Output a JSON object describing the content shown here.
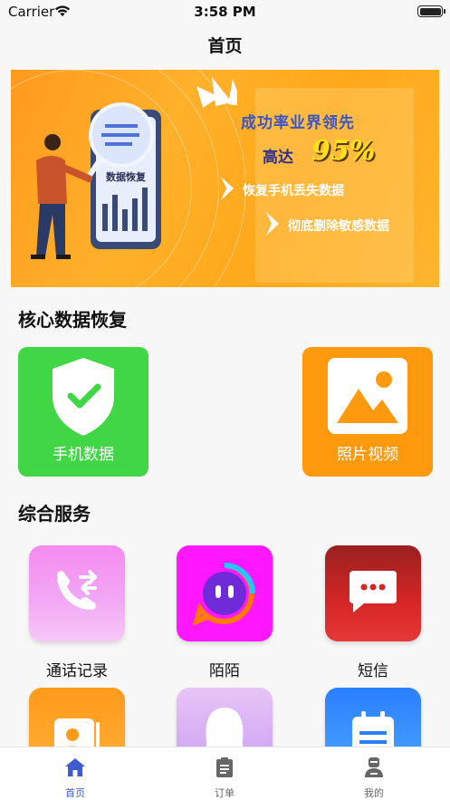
{
  "status_bar": {
    "carrier": "Carrier",
    "time": "3:58 PM"
  },
  "nav": {
    "title": "首页"
  },
  "banner": {
    "phone_label": "数据恢复",
    "headline1": "成功率业界领先",
    "headline2": "高达",
    "percent": "95%",
    "bullet1": "恢复手机丢失数据",
    "bullet2": "彻底删除敏感数据",
    "colors": {
      "background": "#ffa81a",
      "percent": "#ffe21a"
    }
  },
  "core_section": {
    "title": "核心数据恢复",
    "tiles": [
      {
        "label": "手机数据",
        "icon": "shield-check-icon",
        "color": "#41d646"
      },
      {
        "label": "照片视频",
        "icon": "image-icon",
        "color": "#ff9a0e"
      }
    ]
  },
  "services_section": {
    "title": "综合服务",
    "items": [
      {
        "label": "通话记录",
        "icon": "call-transfer-icon"
      },
      {
        "label": "陌陌",
        "icon": "momo-icon"
      },
      {
        "label": "短信",
        "icon": "message-icon"
      }
    ]
  },
  "tab_bar": {
    "active_color": "#3d5cd0",
    "inactive_color": "#666666",
    "items": [
      {
        "label": "首页",
        "icon": "home-icon",
        "active": true
      },
      {
        "label": "订单",
        "icon": "clipboard-icon",
        "active": false
      },
      {
        "label": "我的",
        "icon": "user-icon",
        "active": false
      }
    ]
  }
}
